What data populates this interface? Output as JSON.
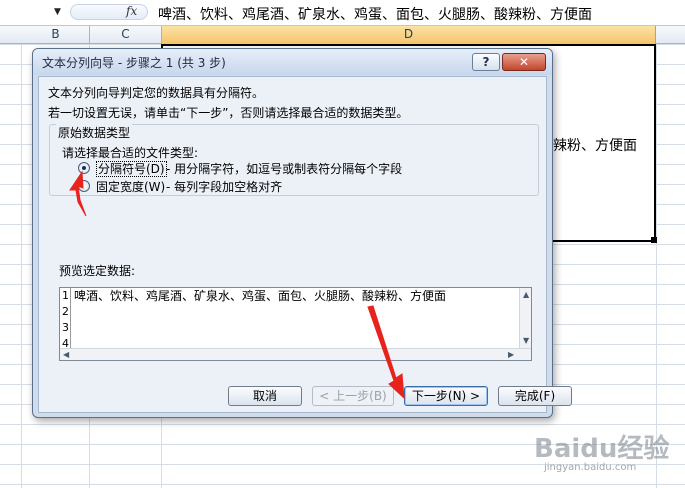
{
  "formula_bar": {
    "fx_label": "fx",
    "content": "啤酒、饮料、鸡尾酒、矿泉水、鸡蛋、面包、火腿肠、酸辣粉、方便面"
  },
  "columns": [
    "B",
    "C",
    "D"
  ],
  "cell_d_visible_text": "辣粉、方便面",
  "dialog": {
    "title": "文本分列向导 - 步骤之 1 (共 3 步)",
    "help_label": "?",
    "close_label": "✕",
    "description_line1": "文本分列向导判定您的数据具有分隔符。",
    "description_line2": "若一切设置无误，请单击“下一步”，否则请选择最合适的数据类型。",
    "group_title": "原始数据类型",
    "group_prompt": "请选择最合适的文件类型:",
    "options": [
      {
        "label": "分隔符号(D)",
        "description": "- 用分隔字符，如逗号或制表符分隔每个字段",
        "selected": true
      },
      {
        "label": "固定宽度(W)",
        "description": "- 每列字段加空格对齐",
        "selected": false
      }
    ],
    "preview_label": "预览选定数据:",
    "preview_rows": [
      {
        "num": "1",
        "text": "啤酒、饮料、鸡尾酒、矿泉水、鸡蛋、面包、火腿肠、酸辣粉、方便面"
      },
      {
        "num": "2",
        "text": ""
      },
      {
        "num": "3",
        "text": ""
      },
      {
        "num": "4",
        "text": ""
      }
    ],
    "buttons": {
      "cancel": "取消",
      "back": "< 上一步(B)",
      "next": "下一步(N) >",
      "finish": "完成(F)"
    }
  },
  "annotation_color": "#e8231c",
  "watermark": {
    "brand": "Baidu经验",
    "url": "jingyan.baidu.com"
  }
}
